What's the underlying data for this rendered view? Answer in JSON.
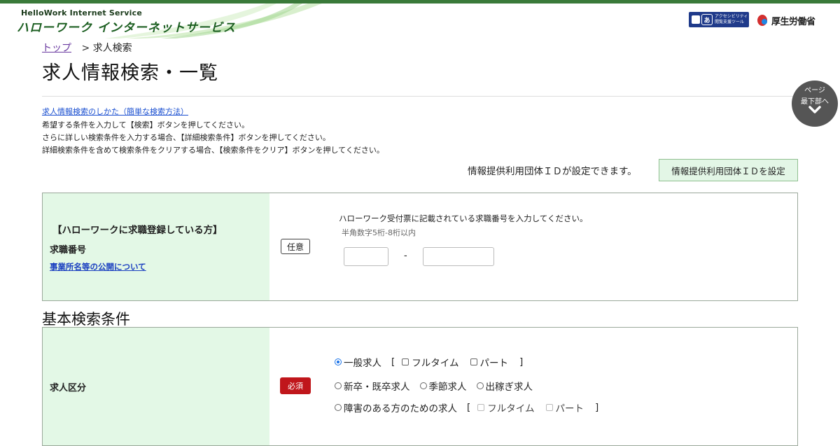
{
  "header": {
    "logo_en": "HelloWork Internet Service",
    "logo_ja": "ハローワーク インターネットサービス",
    "a11y_text1": "アクセシビリティ",
    "a11y_text2": "閲覧支援ツール",
    "mhlw": "厚生労働省"
  },
  "breadcrumb": {
    "home": "トップ",
    "sep": ">",
    "current": "求人検索"
  },
  "page_title": "求人情報検索・一覧",
  "scroll_fab": {
    "line1": "ページ",
    "line2": "最下部へ",
    "icon": "chevron-down-icon"
  },
  "intro": {
    "howto_link": "求人情報検索のしかた（簡単な検索方法）",
    "lines": [
      "希望する条件を入力して【検索】ボタンを押してください。",
      "さらに詳しい検索条件を入力する場合、【詳細検索条件】ボタンを押してください。",
      "詳細検索条件を含めて検索条件をクリアする場合、【検索条件をクリア】ボタンを押してください。"
    ],
    "id_note": "情報提供利用団体ＩＤが設定できます。",
    "id_button": "情報提供利用団体ＩＤを設定"
  },
  "registration": {
    "title": "【ハローワークに求職登録している方】",
    "field": "求職番号",
    "link": "事業所名等の公開について",
    "badge": "任意",
    "instruction": "ハローワーク受付票に記載されている求職番号を入力してください。",
    "hint": "半角数字5桁-8桁以内",
    "input1_value": "",
    "separator": "-",
    "input2_value": ""
  },
  "basic": {
    "section_title": "基本検索条件",
    "label": "求人区分",
    "badge": "必須",
    "options": {
      "general": "一般求人",
      "fulltime": "フルタイム",
      "part": "パート",
      "new_grad": "新卒・既卒求人",
      "seasonal": "季節求人",
      "migrant": "出稼ぎ求人",
      "disabled": "障害のある方のための求人",
      "dis_fulltime": "フルタイム",
      "dis_part": "パート",
      "open": "[",
      "close": "]"
    }
  }
}
